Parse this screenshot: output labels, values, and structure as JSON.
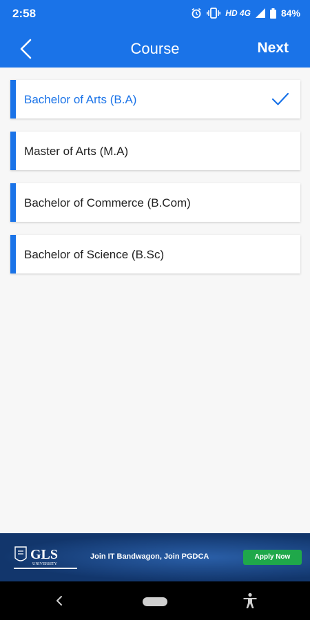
{
  "status_bar": {
    "time": "2:58",
    "network": "HD 4G",
    "battery": "84%",
    "icons": [
      "alarm-icon",
      "vibrate-icon",
      "signal-icon",
      "battery-icon"
    ]
  },
  "app_bar": {
    "back_icon": "chevron-left-icon",
    "title": "Course",
    "next_label": "Next"
  },
  "courses": [
    {
      "label": "Bachelor of Arts (B.A)",
      "selected": true
    },
    {
      "label": "Master of Arts (M.A)",
      "selected": false
    },
    {
      "label": "Bachelor of Commerce (B.Com)",
      "selected": false
    },
    {
      "label": "Bachelor of Science (B.Sc)",
      "selected": false
    }
  ],
  "ad": {
    "logo_text": "GLS",
    "logo_subtext": "UNIVERSITY",
    "text": "Join IT Bandwagon, Join PGDCA",
    "cta": "Apply Now"
  },
  "colors": {
    "primary": "#1a73e8",
    "background": "#f7f7f7",
    "ad_cta": "#1fa84a"
  }
}
